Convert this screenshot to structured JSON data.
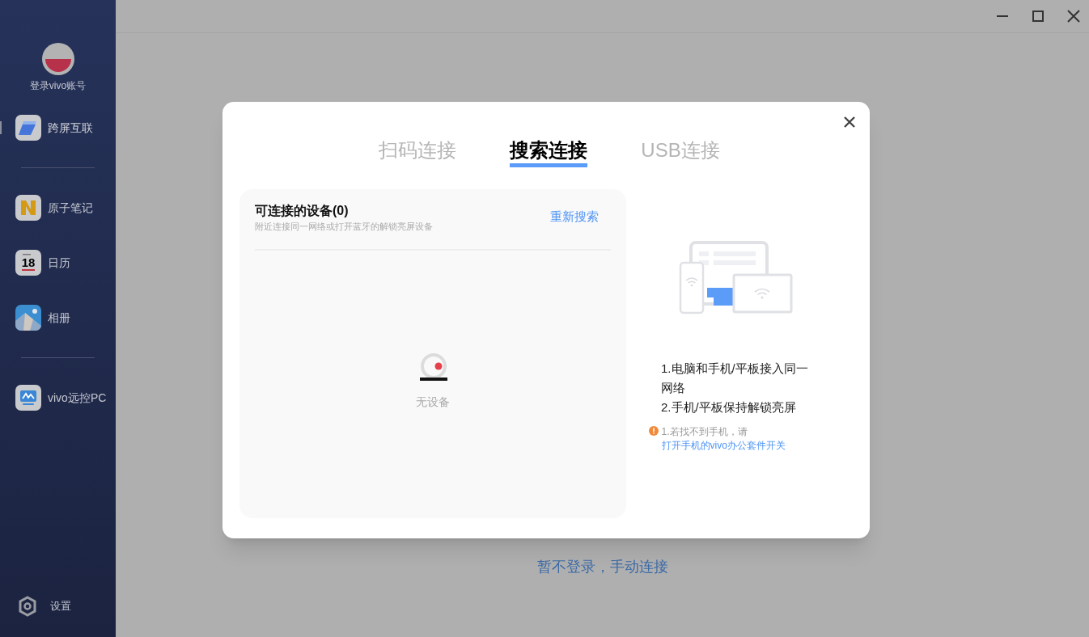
{
  "sidebar": {
    "account": {
      "label": "登录vivo账号"
    },
    "groups": [
      {
        "items": [
          {
            "kind": "cross-screen",
            "label": "跨屏互联",
            "selected": true
          }
        ]
      },
      {
        "items": [
          {
            "kind": "notes",
            "label": "原子笔记",
            "selected": false
          },
          {
            "kind": "calendar",
            "label": "日历",
            "icon_text": "18",
            "selected": false
          },
          {
            "kind": "album",
            "label": "相册",
            "selected": false
          }
        ]
      },
      {
        "items": [
          {
            "kind": "remote-pc",
            "label": "vivo远控PC",
            "selected": false
          }
        ]
      }
    ],
    "settings": {
      "label": "设置"
    }
  },
  "dialog": {
    "tabs": [
      {
        "label": "扫码连接",
        "selected": false
      },
      {
        "label": "搜索连接",
        "selected": true
      },
      {
        "label": "USB连接",
        "selected": false
      }
    ],
    "devices_panel": {
      "title": "可连接的设备(0)",
      "subtitle": "附近连接同一网络或打开蓝牙的解锁亮屏设备",
      "refresh": "重新搜索",
      "empty_text": "无设备"
    },
    "steps": [
      "1.电脑和手机/平板接入同一网络",
      "2.手机/平板保持解锁亮屏"
    ],
    "tip": {
      "text": "1.若找不到手机，请",
      "link": "打开手机的vivo办公套件开关"
    }
  },
  "manual_connect_link": "暂不登录，手动连接"
}
